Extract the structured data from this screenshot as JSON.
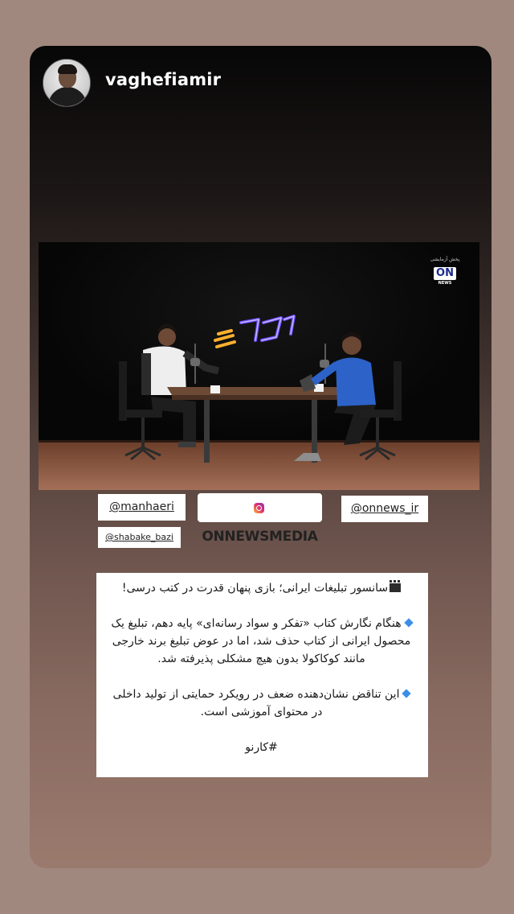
{
  "story": {
    "username": "vaghefiamir"
  },
  "video": {
    "badge_live": "پخش آزمایشی",
    "badge_mark": "ON",
    "badge_news": "NEWS",
    "show_logo_text": "کارنو"
  },
  "tags": {
    "manhaeri": "@manhaeri",
    "onnews_media": "ONNEWSMEDIA",
    "onnews_ir": "@onnews_ir",
    "shabake_bazi": "@shabake_bazi"
  },
  "caption": {
    "line1": "سانسور تبلیغات ایرانی؛ بازی پنهان قدرت در کتب درسی!",
    "para1": "هنگام نگارش کتاب «تفکر و سواد رسانه‌ای» پایه دهم، تبلیغ یک محصول ایرانی از کتاب حذف شد، اما در عوض تبلیغ برند خارجی مانند کوکاکولا بدون هیچ مشکلی پذیرفته شد.",
    "para2": "این تناقض نشان‌دهنده ضعف در رویکرد حمایتی از تولید داخلی در محتوای آموزشی است.",
    "hashtag": "#کارنو"
  },
  "icons": {
    "caption_lead": "clapperboard-icon",
    "bullet": "blue-diamond-icon",
    "tag_brand": "instagram-icon"
  }
}
